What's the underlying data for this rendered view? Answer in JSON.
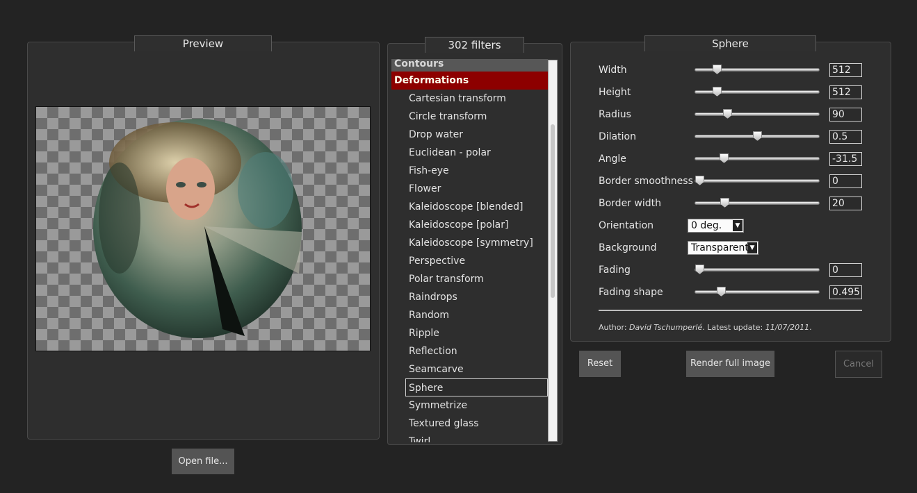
{
  "preview": {
    "title": "Preview",
    "open_button": "Open file..."
  },
  "filters": {
    "title": "302 filters",
    "categories": {
      "contours": "Contours",
      "deformations": "Deformations"
    },
    "items": [
      "Cartesian transform",
      "Circle transform",
      "Drop water",
      "Euclidean - polar",
      "Fish-eye",
      "Flower",
      "Kaleidoscope [blended]",
      "Kaleidoscope [polar]",
      "Kaleidoscope [symmetry]",
      "Perspective",
      "Polar transform",
      "Raindrops",
      "Random",
      "Ripple",
      "Reflection",
      "Seamcarve",
      "Sphere",
      "Symmetrize",
      "Textured glass",
      "Twirl"
    ],
    "selected": "Sphere"
  },
  "params": {
    "title": "Sphere",
    "width": {
      "label": "Width",
      "value": "512",
      "level": 0.15
    },
    "height": {
      "label": "Height",
      "value": "512",
      "level": 0.15
    },
    "radius": {
      "label": "Radius",
      "value": "90",
      "level": 0.24
    },
    "dilation": {
      "label": "Dilation",
      "value": "0.5",
      "level": 0.5
    },
    "angle": {
      "label": "Angle",
      "value": "-31.5",
      "level": 0.21
    },
    "border_smoothness": {
      "label": "Border smoothness",
      "value": "0",
      "level": 0.0
    },
    "border_width": {
      "label": "Border width",
      "value": "20",
      "level": 0.22
    },
    "orientation": {
      "label": "Orientation",
      "value": "0 deg."
    },
    "background": {
      "label": "Background",
      "value": "Transparent"
    },
    "fading": {
      "label": "Fading",
      "value": "0",
      "level": 0.0
    },
    "fading_shape": {
      "label": "Fading shape",
      "value": "0.495",
      "level": 0.19
    },
    "author_prefix": "Author: ",
    "author_name": "David Tschumperlé",
    "update_prefix": ". Latest update: ",
    "update_date": "11/07/2011",
    "update_suffix": "."
  },
  "actions": {
    "reset": "Reset",
    "render": "Render full image",
    "cancel": "Cancel"
  }
}
